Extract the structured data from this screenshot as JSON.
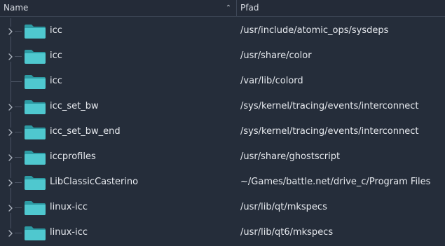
{
  "header": {
    "name_label": "Name",
    "path_label": "Pfad",
    "sort_icon": "chevron-up-icon"
  },
  "rows": [
    {
      "name": "icc",
      "path": "/usr/include/atomic_ops/sysdeps",
      "expandable": true
    },
    {
      "name": "icc",
      "path": "/usr/share/color",
      "expandable": true
    },
    {
      "name": "icc",
      "path": "/var/lib/colord",
      "expandable": false
    },
    {
      "name": "icc_set_bw",
      "path": "/sys/kernel/tracing/events/interconnect",
      "expandable": true
    },
    {
      "name": "icc_set_bw_end",
      "path": "/sys/kernel/tracing/events/interconnect",
      "expandable": true
    },
    {
      "name": "iccprofiles",
      "path": "/usr/share/ghostscript",
      "expandable": true
    },
    {
      "name": "LibClassicCasterino",
      "path": "~/Games/battle.net/drive_c/Program Files",
      "expandable": true
    },
    {
      "name": "linux-icc",
      "path": "/usr/lib/qt/mkspecs",
      "expandable": true
    },
    {
      "name": "linux-icc",
      "path": "/usr/lib/qt6/mkspecs",
      "expandable": true
    }
  ],
  "colors": {
    "background": "#252d3a",
    "folder_front": "#4fc8cf",
    "folder_back": "#2d9aa3",
    "text": "#e6e9ee"
  },
  "icons": {
    "folder": "folder-icon",
    "expander": "chevron-right-icon"
  }
}
